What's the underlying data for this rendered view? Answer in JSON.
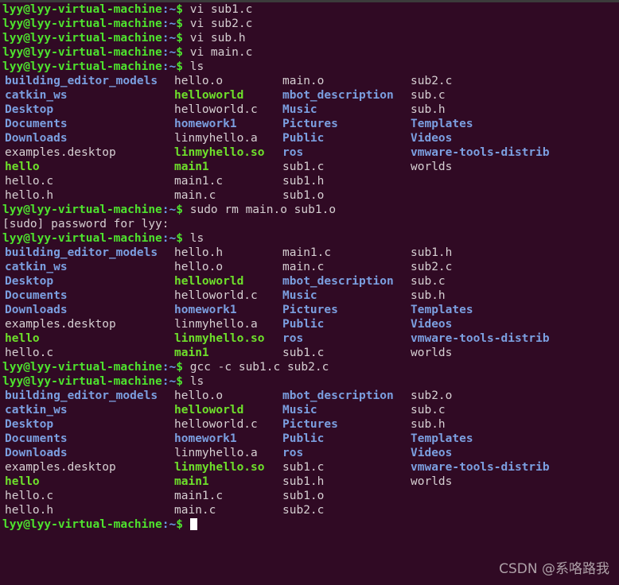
{
  "terminal": {
    "background": "#300a24",
    "prompt": {
      "user_host": "lyy@lyy-virtual-machine",
      "colon": ":",
      "path": "~",
      "sigil": "$"
    },
    "colors": {
      "prompt_green": "#4ee22e",
      "directory_blue": "#7b9fe0",
      "executable_green": "#6ee02b",
      "plain_file": "#d6cfd2",
      "cursor": "#ffffff"
    },
    "lines": [
      {
        "type": "prompt",
        "command": "vi sub1.c"
      },
      {
        "type": "prompt",
        "command": "vi sub2.c"
      },
      {
        "type": "prompt",
        "command": "vi sub.h"
      },
      {
        "type": "prompt",
        "command": "vi main.c"
      },
      {
        "type": "prompt",
        "command": "ls"
      },
      {
        "type": "ls",
        "cells": [
          [
            {
              "t": "building_editor_models",
              "k": "dir"
            },
            {
              "t": "hello.o",
              "k": "file"
            },
            {
              "t": "main.o",
              "k": "file"
            },
            {
              "t": "sub2.c",
              "k": "file"
            }
          ],
          [
            {
              "t": "catkin_ws",
              "k": "dir"
            },
            {
              "t": "helloworld",
              "k": "exec"
            },
            {
              "t": "mbot_description",
              "k": "dir"
            },
            {
              "t": "sub.c",
              "k": "file"
            }
          ],
          [
            {
              "t": "Desktop",
              "k": "dir"
            },
            {
              "t": "helloworld.c",
              "k": "file"
            },
            {
              "t": "Music",
              "k": "dir"
            },
            {
              "t": "sub.h",
              "k": "file"
            }
          ],
          [
            {
              "t": "Documents",
              "k": "dir"
            },
            {
              "t": "homework1",
              "k": "dir"
            },
            {
              "t": "Pictures",
              "k": "dir"
            },
            {
              "t": "Templates",
              "k": "dir"
            }
          ],
          [
            {
              "t": "Downloads",
              "k": "dir"
            },
            {
              "t": "linmyhello.a",
              "k": "file"
            },
            {
              "t": "Public",
              "k": "dir"
            },
            {
              "t": "Videos",
              "k": "dir"
            }
          ],
          [
            {
              "t": "examples.desktop",
              "k": "file"
            },
            {
              "t": "linmyhello.so",
              "k": "exec"
            },
            {
              "t": "ros",
              "k": "dir"
            },
            {
              "t": "vmware-tools-distrib",
              "k": "dir"
            }
          ],
          [
            {
              "t": "hello",
              "k": "exec"
            },
            {
              "t": "main1",
              "k": "exec"
            },
            {
              "t": "sub1.c",
              "k": "file"
            },
            {
              "t": "worlds",
              "k": "file"
            }
          ],
          [
            {
              "t": "hello.c",
              "k": "file"
            },
            {
              "t": "main1.c",
              "k": "file"
            },
            {
              "t": "sub1.h",
              "k": "file"
            },
            {
              "t": "",
              "k": "file"
            }
          ],
          [
            {
              "t": "hello.h",
              "k": "file"
            },
            {
              "t": "main.c",
              "k": "file"
            },
            {
              "t": "sub1.o",
              "k": "file"
            },
            {
              "t": "",
              "k": "file"
            }
          ]
        ]
      },
      {
        "type": "prompt",
        "command": "sudo rm main.o sub1.o"
      },
      {
        "type": "output",
        "text": "[sudo] password for lyy:"
      },
      {
        "type": "prompt",
        "command": "ls"
      },
      {
        "type": "ls",
        "cells": [
          [
            {
              "t": "building_editor_models",
              "k": "dir"
            },
            {
              "t": "hello.h",
              "k": "file"
            },
            {
              "t": "main1.c",
              "k": "file"
            },
            {
              "t": "sub1.h",
              "k": "file"
            }
          ],
          [
            {
              "t": "catkin_ws",
              "k": "dir"
            },
            {
              "t": "hello.o",
              "k": "file"
            },
            {
              "t": "main.c",
              "k": "file"
            },
            {
              "t": "sub2.c",
              "k": "file"
            }
          ],
          [
            {
              "t": "Desktop",
              "k": "dir"
            },
            {
              "t": "helloworld",
              "k": "exec"
            },
            {
              "t": "mbot_description",
              "k": "dir"
            },
            {
              "t": "sub.c",
              "k": "file"
            }
          ],
          [
            {
              "t": "Documents",
              "k": "dir"
            },
            {
              "t": "helloworld.c",
              "k": "file"
            },
            {
              "t": "Music",
              "k": "dir"
            },
            {
              "t": "sub.h",
              "k": "file"
            }
          ],
          [
            {
              "t": "Downloads",
              "k": "dir"
            },
            {
              "t": "homework1",
              "k": "dir"
            },
            {
              "t": "Pictures",
              "k": "dir"
            },
            {
              "t": "Templates",
              "k": "dir"
            }
          ],
          [
            {
              "t": "examples.desktop",
              "k": "file"
            },
            {
              "t": "linmyhello.a",
              "k": "file"
            },
            {
              "t": "Public",
              "k": "dir"
            },
            {
              "t": "Videos",
              "k": "dir"
            }
          ],
          [
            {
              "t": "hello",
              "k": "exec"
            },
            {
              "t": "linmyhello.so",
              "k": "exec"
            },
            {
              "t": "ros",
              "k": "dir"
            },
            {
              "t": "vmware-tools-distrib",
              "k": "dir"
            }
          ],
          [
            {
              "t": "hello.c",
              "k": "file"
            },
            {
              "t": "main1",
              "k": "exec"
            },
            {
              "t": "sub1.c",
              "k": "file"
            },
            {
              "t": "worlds",
              "k": "file"
            }
          ]
        ]
      },
      {
        "type": "prompt",
        "command": "gcc -c sub1.c sub2.c"
      },
      {
        "type": "prompt",
        "command": "ls"
      },
      {
        "type": "ls",
        "cells": [
          [
            {
              "t": "building_editor_models",
              "k": "dir"
            },
            {
              "t": "hello.o",
              "k": "file"
            },
            {
              "t": "mbot_description",
              "k": "dir"
            },
            {
              "t": "sub2.o",
              "k": "file"
            }
          ],
          [
            {
              "t": "catkin_ws",
              "k": "dir"
            },
            {
              "t": "helloworld",
              "k": "exec"
            },
            {
              "t": "Music",
              "k": "dir"
            },
            {
              "t": "sub.c",
              "k": "file"
            }
          ],
          [
            {
              "t": "Desktop",
              "k": "dir"
            },
            {
              "t": "helloworld.c",
              "k": "file"
            },
            {
              "t": "Pictures",
              "k": "dir"
            },
            {
              "t": "sub.h",
              "k": "file"
            }
          ],
          [
            {
              "t": "Documents",
              "k": "dir"
            },
            {
              "t": "homework1",
              "k": "dir"
            },
            {
              "t": "Public",
              "k": "dir"
            },
            {
              "t": "Templates",
              "k": "dir"
            }
          ],
          [
            {
              "t": "Downloads",
              "k": "dir"
            },
            {
              "t": "linmyhello.a",
              "k": "file"
            },
            {
              "t": "ros",
              "k": "dir"
            },
            {
              "t": "Videos",
              "k": "dir"
            }
          ],
          [
            {
              "t": "examples.desktop",
              "k": "file"
            },
            {
              "t": "linmyhello.so",
              "k": "exec"
            },
            {
              "t": "sub1.c",
              "k": "file"
            },
            {
              "t": "vmware-tools-distrib",
              "k": "dir"
            }
          ],
          [
            {
              "t": "hello",
              "k": "exec"
            },
            {
              "t": "main1",
              "k": "exec"
            },
            {
              "t": "sub1.h",
              "k": "file"
            },
            {
              "t": "worlds",
              "k": "file"
            }
          ],
          [
            {
              "t": "hello.c",
              "k": "file"
            },
            {
              "t": "main1.c",
              "k": "file"
            },
            {
              "t": "sub1.o",
              "k": "file"
            },
            {
              "t": "",
              "k": "file"
            }
          ],
          [
            {
              "t": "hello.h",
              "k": "file"
            },
            {
              "t": "main.c",
              "k": "file"
            },
            {
              "t": "sub2.c",
              "k": "file"
            },
            {
              "t": "",
              "k": "file"
            }
          ]
        ]
      },
      {
        "type": "prompt",
        "command": "",
        "cursor": true
      }
    ]
  },
  "watermark": {
    "text": "CSDN @系咯路我"
  }
}
